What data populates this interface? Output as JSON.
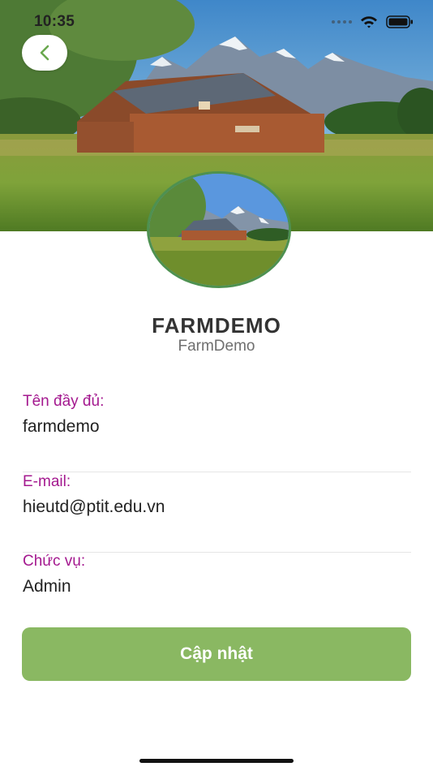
{
  "status_bar": {
    "time": "10:35",
    "icons": [
      "signal-icon",
      "wifi-icon",
      "battery-icon"
    ]
  },
  "header": {
    "back_icon": "chevron-left-icon",
    "cover_image": "farm-landscape-image"
  },
  "profile": {
    "display_name": "FARMDEMO",
    "username": "FarmDemo",
    "avatar_image": "farm-landscape-avatar"
  },
  "fields": [
    {
      "label": "Tên đầy đủ:",
      "value": "farmdemo"
    },
    {
      "label": "E-mail:",
      "value": "hieutd@ptit.edu.vn"
    },
    {
      "label": "Chức vụ:",
      "value": "Admin"
    }
  ],
  "actions": {
    "update_label": "Cập nhật"
  },
  "colors": {
    "label": "#a4198f",
    "button": "#8ab862",
    "avatar_border": "#4e9150",
    "back_chevron": "#6aa84f"
  }
}
